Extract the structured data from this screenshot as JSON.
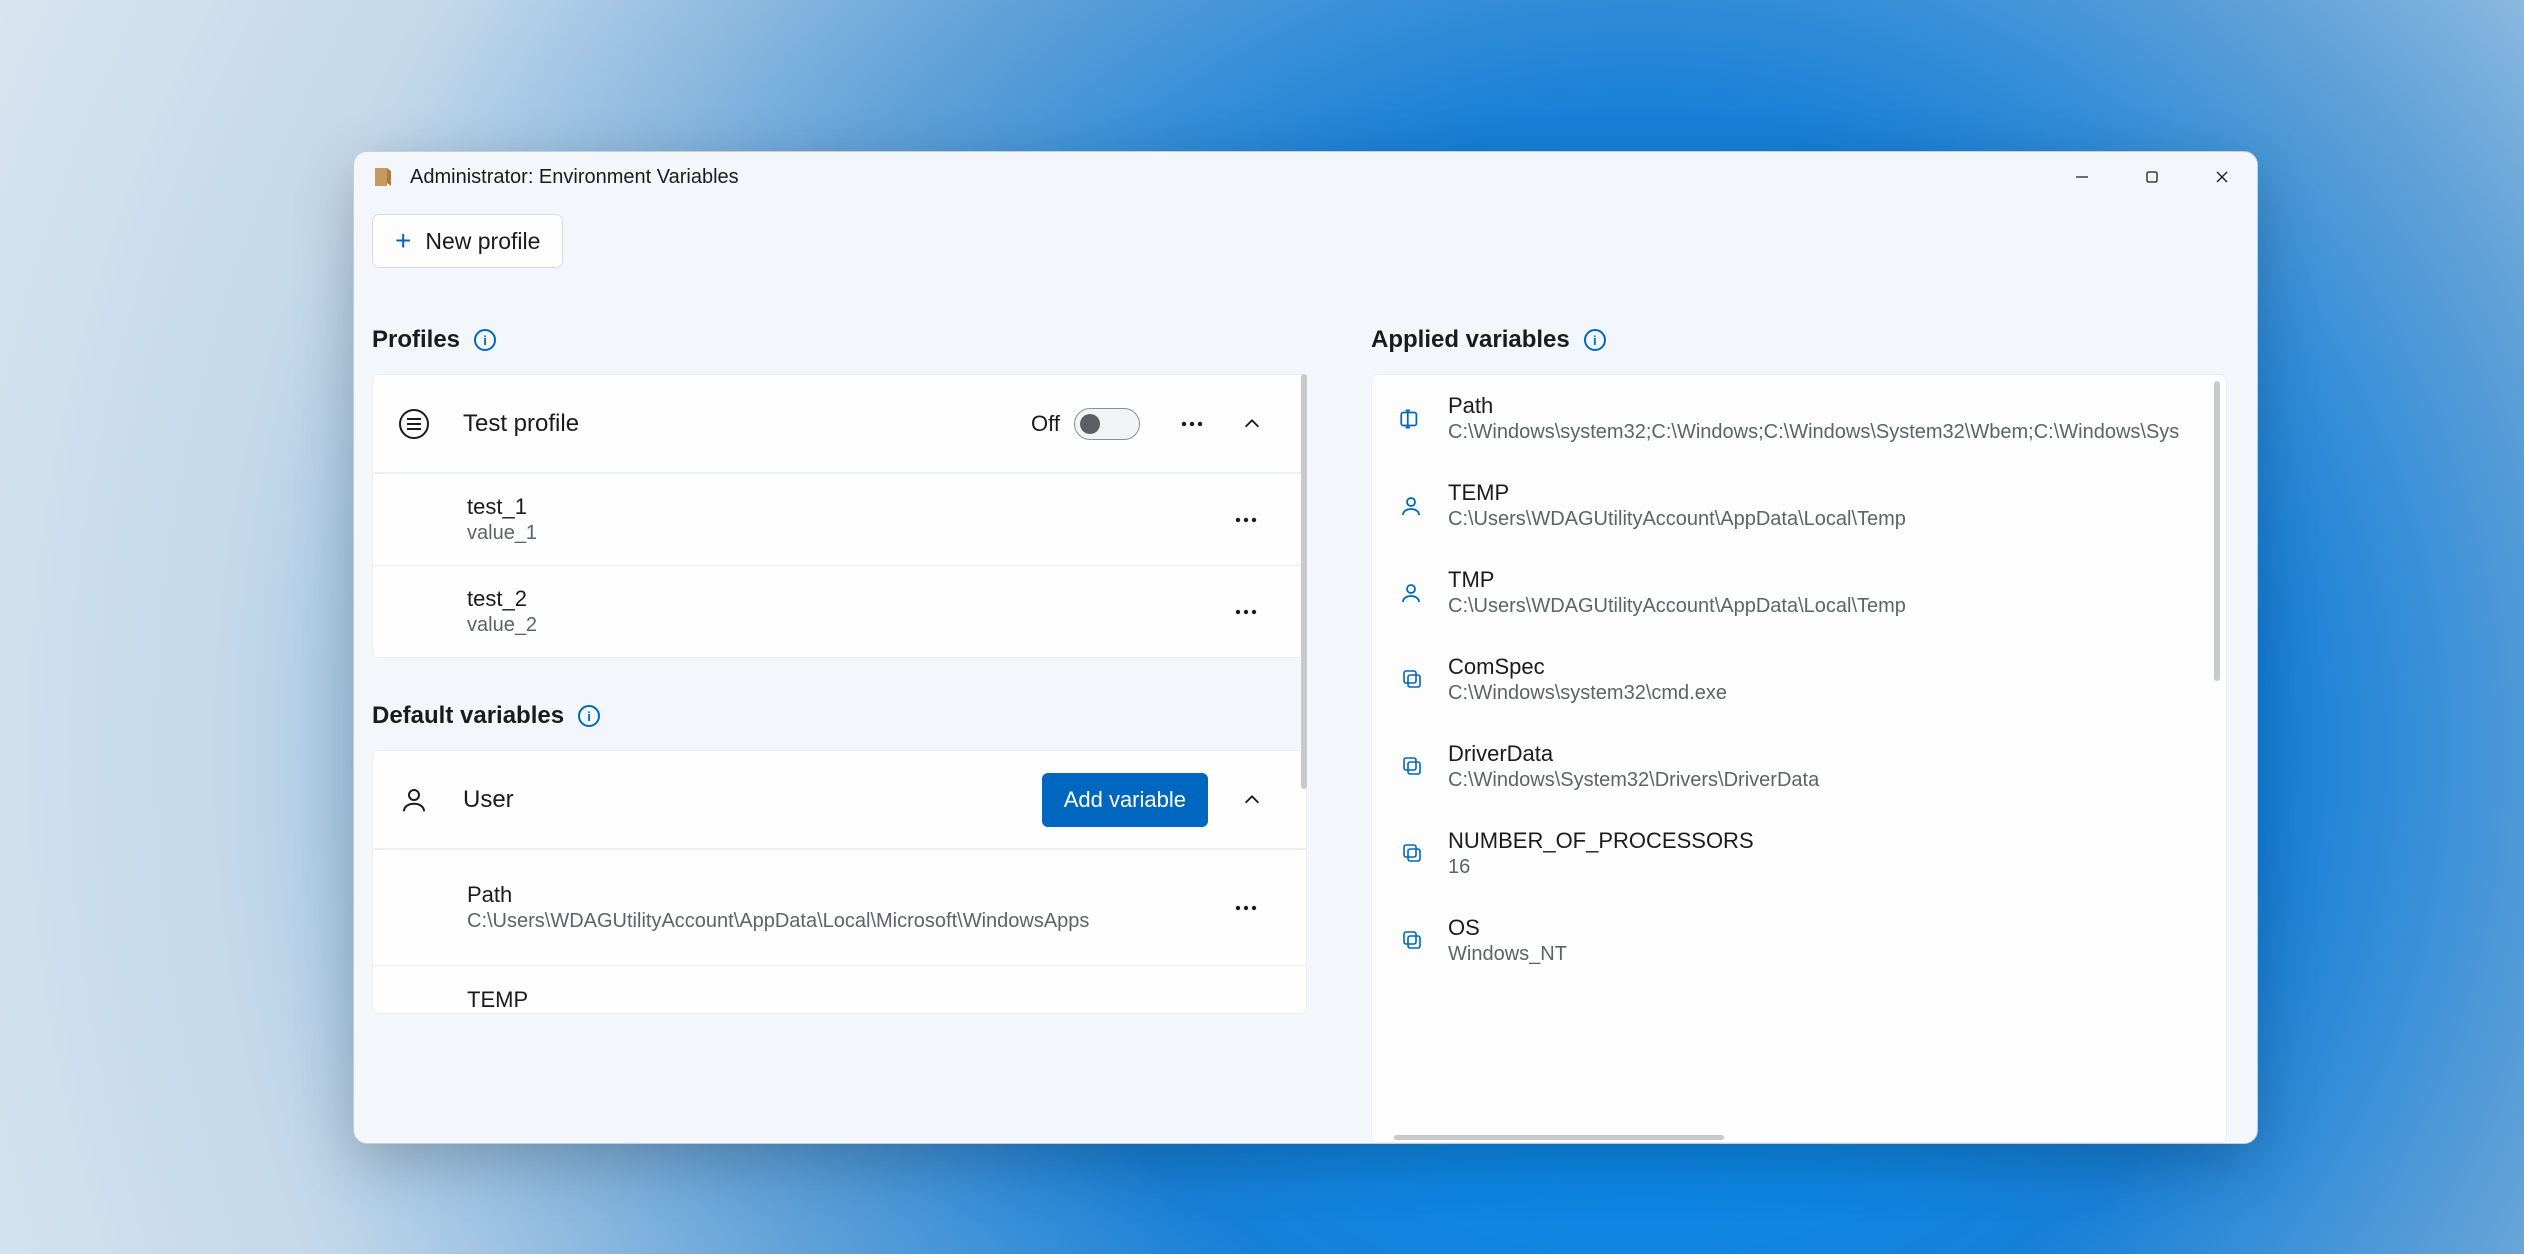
{
  "window_title": "Administrator: Environment Variables",
  "toolbar": {
    "new_profile_label": "New profile"
  },
  "sections": {
    "profiles_label": "Profiles",
    "defaults_label": "Default variables",
    "applied_label": "Applied variables"
  },
  "profile": {
    "name": "Test profile",
    "toggle_label": "Off",
    "variables": [
      {
        "name": "test_1",
        "value": "value_1"
      },
      {
        "name": "test_2",
        "value": "value_2"
      }
    ]
  },
  "defaults": {
    "group_label": "User",
    "add_variable_label": "Add variable",
    "variables": [
      {
        "name": "Path",
        "value": "C:\\Users\\WDAGUtilityAccount\\AppData\\Local\\Microsoft\\WindowsApps"
      },
      {
        "name": "TEMP",
        "value": ""
      }
    ]
  },
  "applied": [
    {
      "icon": "rename",
      "name": "Path",
      "value": "C:\\Windows\\system32;C:\\Windows;C:\\Windows\\System32\\Wbem;C:\\Windows\\Sys"
    },
    {
      "icon": "user",
      "name": "TEMP",
      "value": "C:\\Users\\WDAGUtilityAccount\\AppData\\Local\\Temp"
    },
    {
      "icon": "user",
      "name": "TMP",
      "value": "C:\\Users\\WDAGUtilityAccount\\AppData\\Local\\Temp"
    },
    {
      "icon": "system",
      "name": "ComSpec",
      "value": "C:\\Windows\\system32\\cmd.exe"
    },
    {
      "icon": "system",
      "name": "DriverData",
      "value": "C:\\Windows\\System32\\Drivers\\DriverData"
    },
    {
      "icon": "system",
      "name": "NUMBER_OF_PROCESSORS",
      "value": "16"
    },
    {
      "icon": "system",
      "name": "OS",
      "value": "Windows_NT"
    }
  ]
}
